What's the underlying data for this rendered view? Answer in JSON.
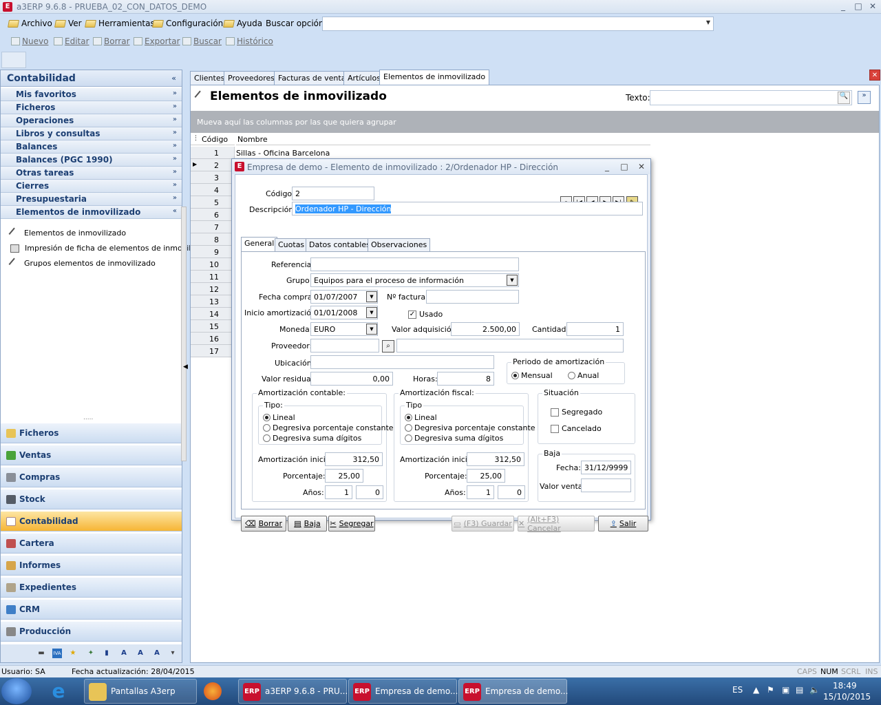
{
  "window": {
    "title": "a3ERP 9.6.8 - PRUEBA_02_CON_DATOS_DEMO",
    "logo": "E",
    "min": "_",
    "max": "□",
    "close": "✕"
  },
  "menu": {
    "items": [
      "Archivo",
      "Ver",
      "Herramientas",
      "Configuración",
      "Ayuda"
    ],
    "search_label": "Buscar opción:",
    "search_value": ""
  },
  "toolbar": {
    "items": [
      "Nuevo",
      "Editar",
      "Borrar",
      "Exportar",
      "Buscar",
      "Histórico"
    ]
  },
  "left": {
    "header": "Contabilidad",
    "collapse": "«",
    "sections": [
      "Mis favoritos",
      "Ficheros",
      "Operaciones",
      "Libros y consultas",
      "Balances",
      "Balances (PGC 1990)",
      "Otras tareas",
      "Cierres",
      "Presupuestaria",
      "Elementos de inmovilizado"
    ],
    "expand_glyph": "»",
    "collapse_glyph": "«",
    "subitems": [
      "Elementos de inmovilizado",
      "Impresión de ficha de elementos de inmoviliz...",
      "Grupos elementos de inmovilizado"
    ],
    "grip": ".....",
    "nav": [
      "Ficheros",
      "Ventas",
      "Compras",
      "Stock",
      "Contabilidad",
      "Cartera",
      "Informes",
      "Expedientes",
      "CRM",
      "Producción"
    ],
    "nav_active": "Contabilidad",
    "bottom_icons": [
      "▬",
      "IVA",
      "★",
      "✦",
      "▮",
      "A",
      "A",
      "A",
      "▾"
    ]
  },
  "tabs": [
    "Clientes",
    "Proveedores",
    "Facturas de venta",
    "Artículos",
    "Elementos de inmovilizado"
  ],
  "tab_close": "✕",
  "main": {
    "title": "Elementos de inmovilizado",
    "texto_label": "Texto:",
    "texto_value": "",
    "search_glyph": "🔍",
    "expand_glyph": "»",
    "group_hint": "Mueva aquí las columnas por las que quiera agrupar",
    "col_code": "Código",
    "col_name": "Nombre",
    "rows": [
      {
        "n": "1",
        "name": "Sillas - Oficina Barcelona"
      },
      {
        "n": "2",
        "name": ""
      },
      {
        "n": "3",
        "name": ""
      },
      {
        "n": "4",
        "name": ""
      },
      {
        "n": "5",
        "name": ""
      },
      {
        "n": "6",
        "name": ""
      },
      {
        "n": "7",
        "name": ""
      },
      {
        "n": "8",
        "name": ""
      },
      {
        "n": "9",
        "name": ""
      },
      {
        "n": "10",
        "name": ""
      },
      {
        "n": "11",
        "name": ""
      },
      {
        "n": "12",
        "name": ""
      },
      {
        "n": "13",
        "name": ""
      },
      {
        "n": "14",
        "name": ""
      },
      {
        "n": "15",
        "name": ""
      },
      {
        "n": "16",
        "name": ""
      },
      {
        "n": "17",
        "name": ""
      }
    ]
  },
  "dialog": {
    "title": "Empresa de demo - Elemento de inmovilizado : 2/Ordenador HP - Dirección",
    "codigo_label": "Código:",
    "codigo": "2",
    "desc_label": "Descripción:",
    "desc": "Ordenador HP - Dirección",
    "tabs": [
      "General",
      "Cuotas",
      "Datos contables",
      "Observaciones"
    ],
    "referencia_label": "Referencia:",
    "referencia": "",
    "grupo_label": "Grupo:",
    "grupo": "Equipos para el proceso de información",
    "fecha_compra_label": "Fecha compra:",
    "fecha_compra": "01/07/2007",
    "nfactura_label": "Nº factura:",
    "nfactura": "",
    "inicio_label": "Inicio amortización:",
    "inicio": "01/01/2008",
    "usado_label": "Usado",
    "moneda_label": "Moneda:",
    "moneda": "EURO",
    "valor_adq_label": "Valor adquisición:",
    "valor_adq": "2.500,00",
    "cantidad_label": "Cantidad:",
    "cantidad": "1",
    "proveedor_label": "Proveedor:",
    "proveedor": "",
    "proveedor_name": "",
    "ubicacion_label": "Ubicación:",
    "ubicacion": "",
    "valor_residual_label": "Valor residual:",
    "valor_residual": "0,00",
    "horas_label": "Horas:",
    "horas": "8",
    "periodo_title": "Periodo de amortización",
    "periodo_opts": [
      "Mensual",
      "Anual"
    ],
    "amort_contable": "Amortización contable:",
    "amort_fiscal": "Amortización fiscal:",
    "tipo_label_c": "Tipo:",
    "tipo_label_f": "Tipo",
    "tipo_opts": [
      "Lineal",
      "Degresiva porcentaje constante",
      "Degresiva suma dígitos"
    ],
    "amort_inicial_label": "Amortización inicial:",
    "amort_inicial_c": "312,50",
    "amort_inicial_f": "312,50",
    "porcentaje_label": "Porcentaje:",
    "porcentaje_c": "25,00",
    "porcentaje_f": "25,00",
    "anos_label": "Años:",
    "anos_c1": "1",
    "anos_c2": "0",
    "anos_f1": "1",
    "anos_f2": "0",
    "situacion_title": "Situación",
    "segregado": "Segregado",
    "cancelado": "Cancelado",
    "baja_title": "Baja",
    "baja_fecha_label": "Fecha:",
    "baja_fecha": "31/12/9999",
    "valor_venta_label": "Valor venta:",
    "valor_venta": "",
    "buttons": {
      "borrar": "Borrar",
      "baja": "Baja",
      "segregar": "Segregar",
      "guardar": "(F3) Guardar",
      "cancelar": "(Alt+F3) Cancelar",
      "salir": "Salir"
    }
  },
  "status": {
    "usuario": "Usuario: SA",
    "fecha": "Fecha actualización: 28/04/2015",
    "caps": "CAPS",
    "num": "NUM",
    "scrl": "SCRL",
    "ins": "INS"
  },
  "taskbar": {
    "items": [
      "Pantallas A3erp",
      "a3ERP 9.6.8 - PRU...",
      "Empresa de demo...",
      "Empresa de demo..."
    ],
    "erp_icon": "ERP",
    "lang": "ES",
    "time": "18:49",
    "date": "15/10/2015",
    "ie_glyph": "e"
  }
}
